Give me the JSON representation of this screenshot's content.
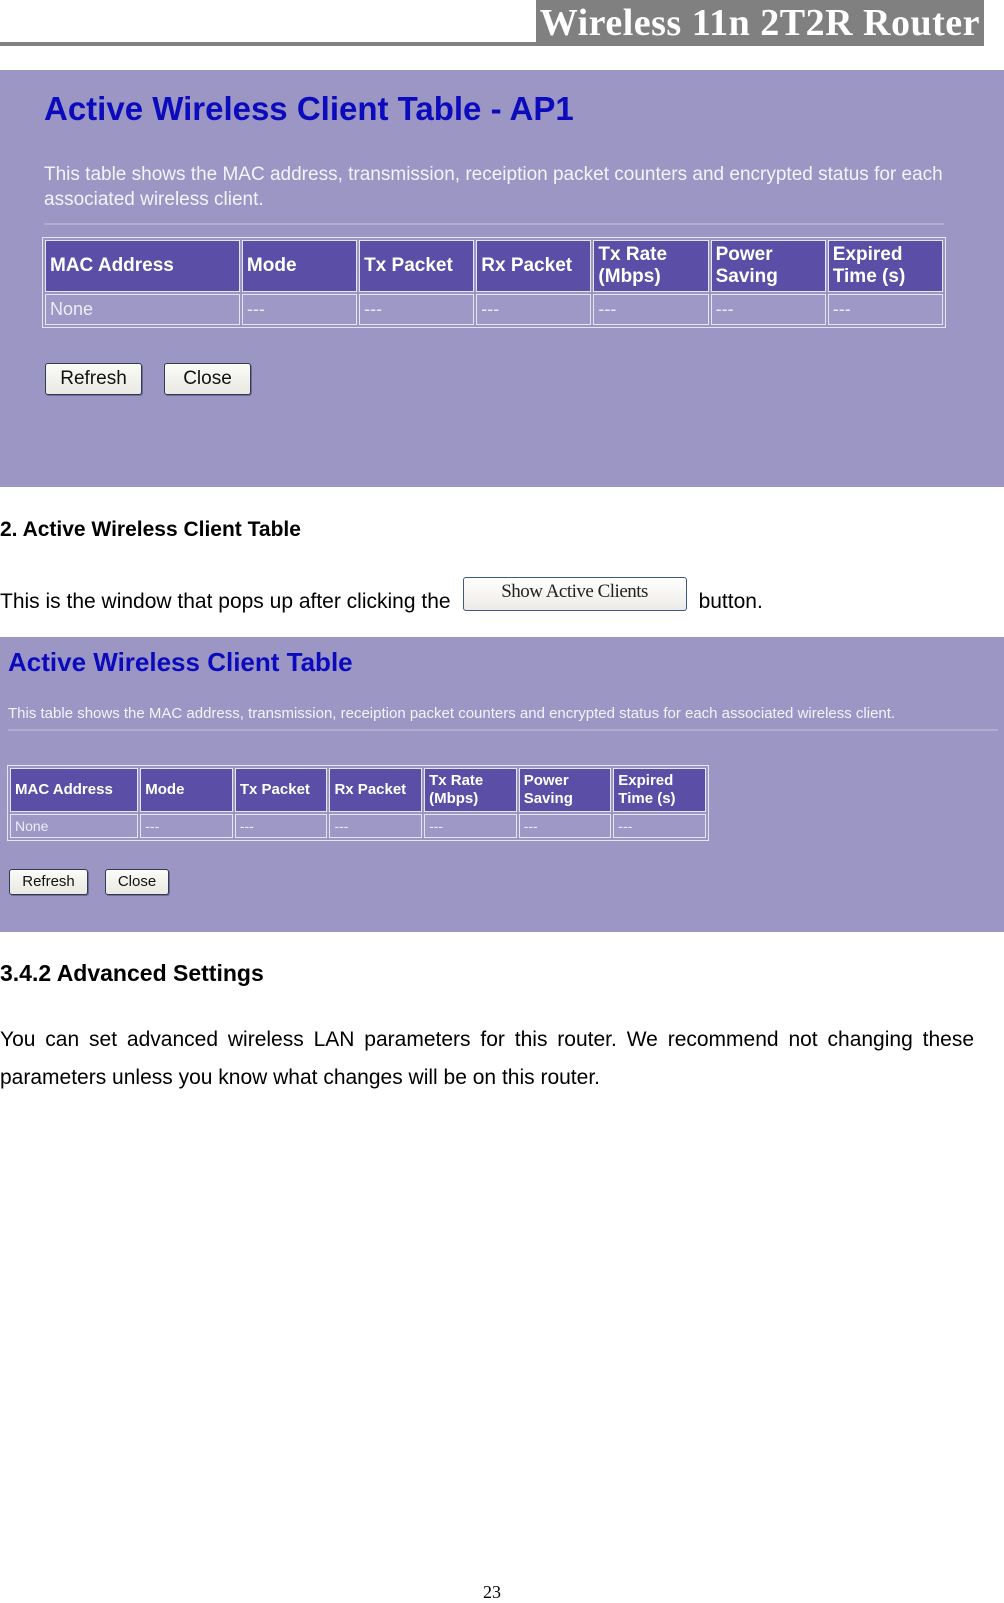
{
  "header": {
    "title": "Wireless 11n 2T2R Router"
  },
  "screenshot_ap1": {
    "title": "Active Wireless Client Table - AP1",
    "description": "This table shows the MAC address, transmission, receiption packet counters and encrypted status for each associated wireless client.",
    "columns": [
      "MAC Address",
      "Mode",
      "Tx Packet",
      "Rx Packet",
      "Tx Rate (Mbps)",
      "Power Saving",
      "Expired Time (s)"
    ],
    "rows": [
      [
        "None",
        "---",
        "---",
        "---",
        "---",
        "---",
        "---"
      ]
    ],
    "buttons": {
      "refresh": "Refresh",
      "close": "Close"
    }
  },
  "section_2": {
    "heading": "2. Active Wireless Client Table",
    "text_before": "This is the window that pops up after clicking the",
    "button_label": "Show Active Clients",
    "text_after": "button."
  },
  "screenshot_main": {
    "title": "Active Wireless Client Table",
    "description": "This table shows the MAC address, transmission, receiption packet counters and encrypted status for each associated wireless client.",
    "columns": [
      "MAC Address",
      "Mode",
      "Tx Packet",
      "Rx Packet",
      "Tx Rate (Mbps)",
      "Power Saving",
      "Expired Time (s)"
    ],
    "rows": [
      [
        "None",
        "---",
        "---",
        "---",
        "---",
        "---",
        "---"
      ]
    ],
    "buttons": {
      "refresh": "Refresh",
      "close": "Close"
    }
  },
  "section_342": {
    "heading": "3.4.2 Advanced Settings",
    "paragraph": "You can set advanced wireless LAN parameters for this router. We recommend not changing these parameters unless you know what changes will be on this router."
  },
  "footer": {
    "page_number": "23"
  }
}
